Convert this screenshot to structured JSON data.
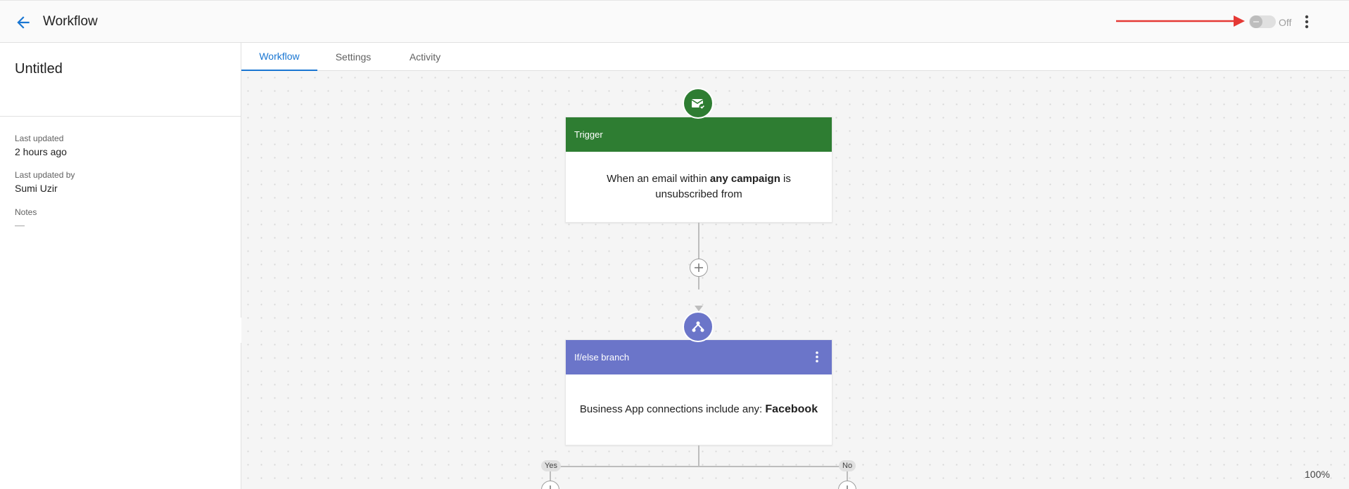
{
  "header": {
    "title": "Workflow",
    "toggle_label": "Off",
    "icons": {
      "back": "arrow-left-icon",
      "more": "more-vertical-icon"
    },
    "accent_color": "#1976d2",
    "annotation_color": "#e53935"
  },
  "sidebar": {
    "workflow_name": "Untitled",
    "meta": [
      {
        "label": "Last updated",
        "value": "2 hours ago"
      },
      {
        "label": "Last updated by",
        "value": "Sumi Uzir"
      },
      {
        "label": "Notes",
        "value": "—"
      }
    ]
  },
  "tabs": [
    {
      "label": "Workflow",
      "active": true
    },
    {
      "label": "Settings",
      "active": false
    },
    {
      "label": "Activity",
      "active": false
    }
  ],
  "canvas": {
    "trigger": {
      "header": "Trigger",
      "body_prefix": "When an email within ",
      "body_bold": "any campaign",
      "body_suffix": " is unsubscribed from",
      "color": "#2e7d32",
      "icon": "email-check-icon"
    },
    "branch": {
      "header": "If/else branch",
      "body_prefix": "Business App connections include any: ",
      "body_bold": "Facebook",
      "color": "#6b75c9",
      "icon": "branch-icon"
    },
    "yes_label": "Yes",
    "no_label": "No",
    "zoom": "100%"
  }
}
